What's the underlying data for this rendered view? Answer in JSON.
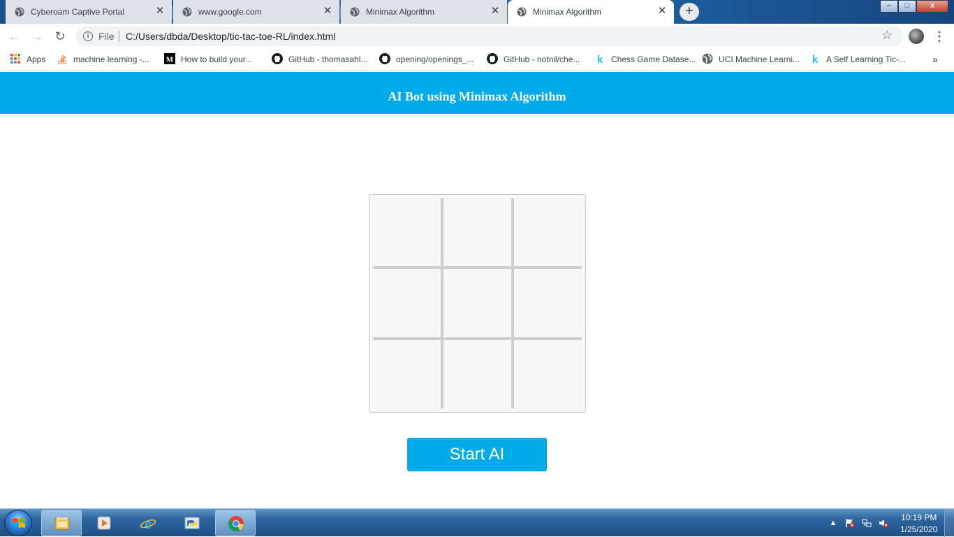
{
  "browser": {
    "tabs": [
      {
        "title": "Cyberoam Captive Portal",
        "icon": "globe-icon",
        "active": false
      },
      {
        "title": "www.google.com",
        "icon": "globe-icon",
        "active": false
      },
      {
        "title": "Minimax Algorithm",
        "icon": "globe-icon",
        "active": false
      },
      {
        "title": "Minimax Algorithm",
        "icon": "globe-icon",
        "active": true
      }
    ],
    "new_tab_glyph": "+",
    "window_controls": {
      "minimize": "–",
      "maximize": "□",
      "close": "x"
    },
    "toolbar": {
      "back_glyph": "←",
      "forward_glyph": "→",
      "reload_glyph": "↻",
      "scheme_label": "File",
      "url": "C:/Users/dbda/Desktop/tic-tac-toe-RL/index.html",
      "star_glyph": "☆",
      "menu_glyph": "⋮"
    },
    "bookmarks": [
      {
        "label": "Apps",
        "icon": "apps-grid-icon"
      },
      {
        "label": "machine learning -...",
        "icon": "stackoverflow-icon"
      },
      {
        "label": "How to build your...",
        "icon": "medium-icon"
      },
      {
        "label": "GitHub - thomasahl...",
        "icon": "github-icon"
      },
      {
        "label": "opening/openings_...",
        "icon": "github-icon"
      },
      {
        "label": "GitHub - notnil/che...",
        "icon": "github-icon"
      },
      {
        "label": "Chess Game Datase...",
        "icon": "kaggle-icon"
      },
      {
        "label": "UCI Machine Learni...",
        "icon": "globe-icon"
      },
      {
        "label": "A Self Learning Tic-...",
        "icon": "kaggle-icon"
      }
    ],
    "bookmarks_overflow_glyph": "»"
  },
  "page": {
    "header_title": "AI Bot using Minimax Algorithm",
    "board": {
      "cells": [
        "",
        "",
        "",
        "",
        "",
        "",
        "",
        "",
        ""
      ]
    },
    "start_button_label": "Start AI",
    "colors": {
      "accent": "#00abe9",
      "board_bg": "#f7f7f7",
      "grid_line": "#cecece"
    }
  },
  "taskbar": {
    "pinned": [
      {
        "name": "file-explorer-icon",
        "active": false
      },
      {
        "name": "media-player-icon",
        "active": false
      },
      {
        "name": "internet-explorer-icon",
        "active": false
      },
      {
        "name": "python-icon",
        "active": false
      },
      {
        "name": "chrome-icon",
        "active": true
      }
    ],
    "clock_time": "10:19 PM",
    "clock_date": "1/25/2020"
  }
}
